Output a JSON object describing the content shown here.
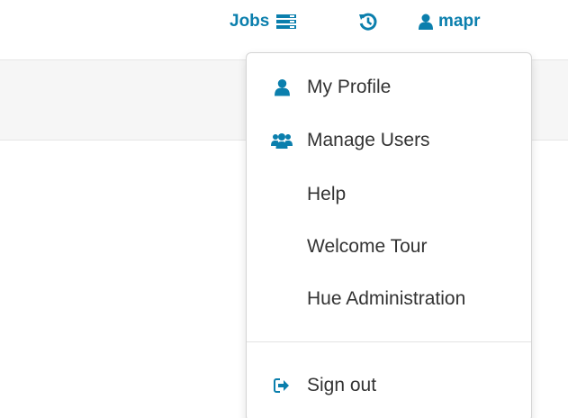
{
  "nav": {
    "jobs_label": "Jobs",
    "user_label": "mapr",
    "icons": {
      "jobs": "server-list-icon",
      "history": "history-icon",
      "user": "user-icon"
    }
  },
  "menu": {
    "items": [
      {
        "label": "My Profile",
        "icon": "user-icon"
      },
      {
        "label": "Manage Users",
        "icon": "users-icon"
      },
      {
        "label": "Help",
        "icon": ""
      },
      {
        "label": "Welcome Tour",
        "icon": ""
      },
      {
        "label": "Hue Administration",
        "icon": ""
      }
    ],
    "sign_out": {
      "label": "Sign out",
      "icon": "sign-out-icon"
    }
  },
  "colors": {
    "accent": "#0B7FAD",
    "text": "#333333",
    "band": "#f6f6f6"
  }
}
